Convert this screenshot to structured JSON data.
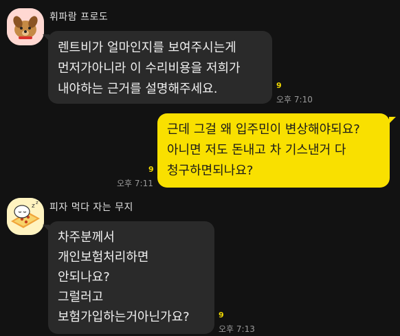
{
  "messages": [
    {
      "sender": "휘파람 프로도",
      "avatar_icon": "dog-character-icon",
      "lines": [
        "렌트비가 얼마인지를 보여주시는게",
        "먼저가아니라 이 수리비용을 저희가",
        "내야하는 근거를 설명해주세요."
      ],
      "unread": "9",
      "time": "오후 7:10"
    },
    {
      "sender": "",
      "lines": [
        "근데 그걸 왜 입주민이 변상해야되요?",
        "아니면 저도 돈내고 차 기스낸거 다",
        "청구하면되나요?"
      ],
      "unread": "9",
      "time": "오후 7:11"
    },
    {
      "sender": "피자 먹다 자는 무지",
      "avatar_icon": "sleeping-character-icon",
      "lines": [
        "차주분께서",
        "개인보험처리하면",
        "안되나요?",
        "그럴러고",
        "보험가입하는거아닌가요?"
      ],
      "unread": "9",
      "time": "오후 7:13"
    }
  ],
  "colors": {
    "background": "#121212",
    "incoming_bubble": "#2a2a2a",
    "outgoing_bubble": "#f9e000",
    "unread_count": "#f2d900"
  }
}
